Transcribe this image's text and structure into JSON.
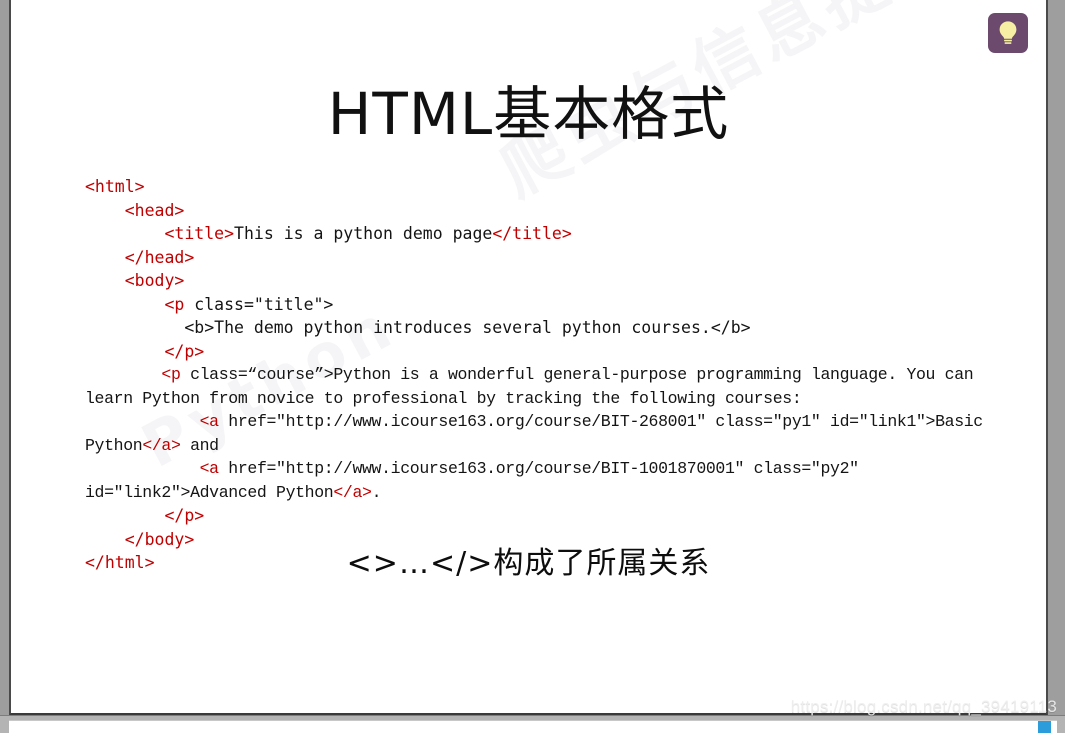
{
  "viewer": {
    "background_color": "#9e9e9e",
    "slide_background": "#ffffff",
    "accent_red": "#c00000",
    "bulb_button_color": "#6b4a6e",
    "bulb_icon_color": "#f7efa4",
    "scrollbar_thumb_color": "#2d9cdb"
  },
  "slide": {
    "title": "HTML基本格式",
    "bottom_caption": "<>…</>构成了所属关系",
    "watermark_text": "爬虫与信息提取",
    "watermark_text_secondary": "Python"
  },
  "bulb_button": {
    "icon": "lightbulb-icon",
    "label": "提示"
  },
  "code": {
    "lines": [
      {
        "indent": 0,
        "segments": [
          {
            "kind": "tag",
            "text": "<html>"
          }
        ]
      },
      {
        "indent": 0,
        "segments": [
          {
            "kind": "txt",
            "text": "    "
          },
          {
            "kind": "tag",
            "text": "<head>"
          }
        ]
      },
      {
        "indent": 0,
        "segments": [
          {
            "kind": "txt",
            "text": "        "
          },
          {
            "kind": "tag",
            "text": "<title>"
          },
          {
            "kind": "txt",
            "text": "This is a python demo page"
          },
          {
            "kind": "tag",
            "text": "</title>"
          }
        ]
      },
      {
        "indent": 0,
        "segments": [
          {
            "kind": "txt",
            "text": "    "
          },
          {
            "kind": "tag",
            "text": "</head>"
          }
        ]
      },
      {
        "indent": 0,
        "segments": [
          {
            "kind": "txt",
            "text": "    "
          },
          {
            "kind": "tag",
            "text": "<body>"
          }
        ]
      },
      {
        "indent": 0,
        "segments": [
          {
            "kind": "txt",
            "text": "        "
          },
          {
            "kind": "tag",
            "text": "<p"
          },
          {
            "kind": "txt",
            "text": " class=\"title\">"
          }
        ]
      },
      {
        "indent": 0,
        "segments": [
          {
            "kind": "txt",
            "text": "          <b>The demo python introduces several python courses.</b>"
          }
        ]
      },
      {
        "indent": 0,
        "segments": [
          {
            "kind": "txt",
            "text": "        "
          },
          {
            "kind": "tag",
            "text": "</p>"
          }
        ]
      },
      {
        "indent": 0,
        "narrow": true,
        "segments": [
          {
            "kind": "txt",
            "text": "        "
          },
          {
            "kind": "tag",
            "text": "<p"
          },
          {
            "kind": "txt",
            "text": " class=“course”>Python is a wonderful general-purpose programming language. You can learn Python from novice to professional by tracking the following courses:"
          }
        ]
      },
      {
        "indent": 0,
        "narrow": true,
        "segments": [
          {
            "kind": "txt",
            "text": "            "
          },
          {
            "kind": "tag",
            "text": "<a"
          },
          {
            "kind": "txt",
            "text": " href=\"http://www.icourse163.org/course/BIT-268001\" class=\"py1\" id=\"link1\">Basic Python"
          },
          {
            "kind": "tag",
            "text": "</a>"
          },
          {
            "kind": "txt",
            "text": " and"
          }
        ]
      },
      {
        "indent": 0,
        "narrow": true,
        "segments": [
          {
            "kind": "txt",
            "text": "            "
          },
          {
            "kind": "tag",
            "text": "<a"
          },
          {
            "kind": "txt",
            "text": " href=\"http://www.icourse163.org/course/BIT-1001870001\" class=\"py2\" id=\"link2\">Advanced Python"
          },
          {
            "kind": "tag",
            "text": "</a>"
          },
          {
            "kind": "txt",
            "text": "."
          }
        ]
      },
      {
        "indent": 0,
        "segments": [
          {
            "kind": "txt",
            "text": "        "
          },
          {
            "kind": "tag",
            "text": "</p>"
          }
        ]
      },
      {
        "indent": 0,
        "segments": [
          {
            "kind": "txt",
            "text": "    "
          },
          {
            "kind": "tag",
            "text": "</body>"
          }
        ]
      },
      {
        "indent": 0,
        "segments": [
          {
            "kind": "tag",
            "text": "</html>"
          }
        ]
      }
    ]
  },
  "url_watermark": "https://blog.csdn.net/qq_39419113"
}
